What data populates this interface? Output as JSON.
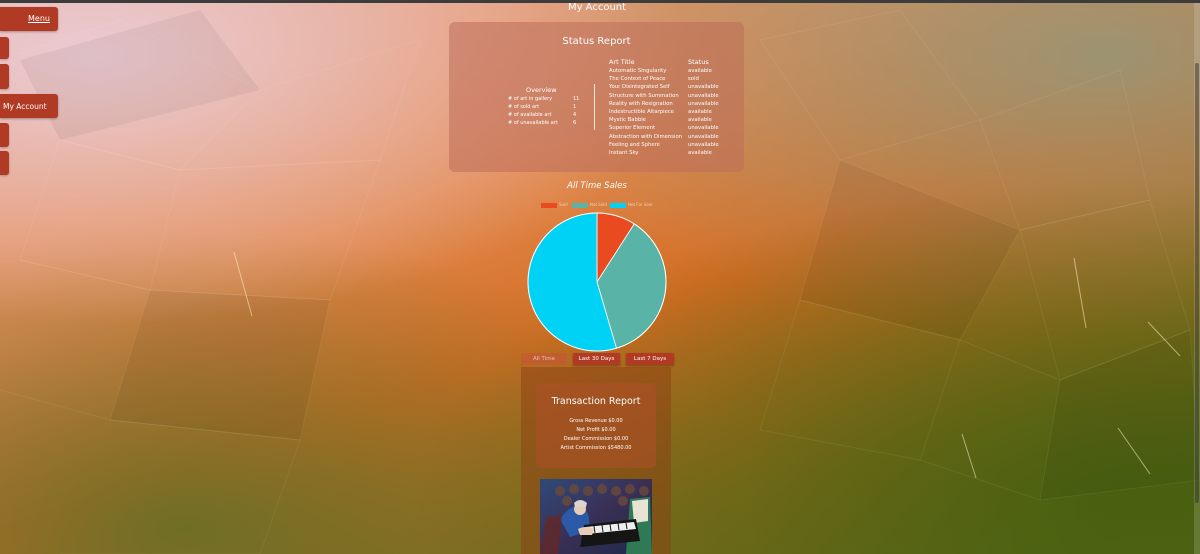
{
  "sidebar": {
    "menu_label": "Menu",
    "my_account_label": "My Account"
  },
  "page": {
    "title": "My Account"
  },
  "status_report": {
    "title": "Status Report",
    "overview": {
      "title": "Overview",
      "rows": [
        {
          "label": "# of art in gallery",
          "value": "11"
        },
        {
          "label": "# of sold art",
          "value": "1"
        },
        {
          "label": "# of available art",
          "value": "4"
        },
        {
          "label": "# of unavailable art",
          "value": "6"
        }
      ]
    },
    "art_table": {
      "col_title": "Art Title",
      "col_status": "Status",
      "rows": [
        {
          "title": "Automatic Singularity",
          "status": "available"
        },
        {
          "title": "The Context of Peace",
          "status": "sold"
        },
        {
          "title": "Your Disintegrated Self",
          "status": "unavailable"
        },
        {
          "title": "Structure with Summation",
          "status": "unavailable"
        },
        {
          "title": "Reality with Resignation",
          "status": "unavailable"
        },
        {
          "title": "Indestructible Altarpiece",
          "status": "available"
        },
        {
          "title": "Mystic Babble",
          "status": "available"
        },
        {
          "title": "Superior Element",
          "status": "unavailable"
        },
        {
          "title": "Abstraction with Dimension",
          "status": "unavailable"
        },
        {
          "title": "Feeling and Sphere",
          "status": "unavailable"
        },
        {
          "title": "Instant Sky",
          "status": "available"
        }
      ]
    }
  },
  "sales": {
    "title": "All Time Sales",
    "legend": [
      {
        "label": "Sold",
        "color": "#ea4a1f"
      },
      {
        "label": "Not Sold",
        "color": "#59b3a6"
      },
      {
        "label": "Not For Sale",
        "color": "#00d2f5"
      }
    ],
    "range_buttons": [
      {
        "label": "All Time",
        "active": false
      },
      {
        "label": "Last 30 Days",
        "active": true
      },
      {
        "label": "Last 7 Days",
        "active": true
      }
    ]
  },
  "chart_data": {
    "type": "pie",
    "title": "All Time Sales",
    "legend_position": "top",
    "labels": [
      "Sold",
      "Not Sold",
      "Not For Sale"
    ],
    "values": [
      1,
      4,
      6
    ],
    "colors": [
      "#ea4a1f",
      "#59b3a6",
      "#00d2f5"
    ]
  },
  "transaction_report": {
    "title": "Transaction Report",
    "lines": [
      "Gross Revenue $0.00",
      "Net Profit $0.00",
      "Dealer Commission $0.00",
      "Artist Commission $5480.00"
    ]
  }
}
